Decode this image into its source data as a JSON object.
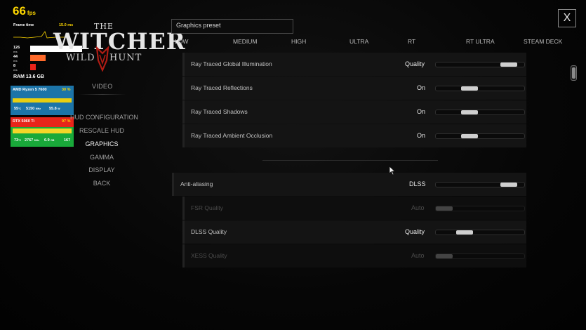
{
  "overlay": {
    "fps_value": "66",
    "fps_unit": "fps",
    "frametime_label": "Frame time",
    "frametime_value": "15.0 ms",
    "bars": [
      {
        "label": "126",
        "unit": "ms",
        "fill": 1.0,
        "color": "#ffffff"
      },
      {
        "label": "44",
        "unit": "ms",
        "fill": 0.25,
        "color": "#ff6a2a"
      },
      {
        "label": "8",
        "unit": "ms",
        "fill": 0.05,
        "color": "#e8241a"
      }
    ],
    "ram_label": "RAM",
    "ram_value": "13.6",
    "ram_unit": "GB",
    "cpu": {
      "name": "AMD Ryzen 5 7600",
      "load": "30 %",
      "temp": "55",
      "temp_unit": "°C",
      "clock": "5150",
      "clock_unit": "MHz",
      "power": "55.8",
      "power_unit": "W"
    },
    "gpu": {
      "name": "RTX 5060 Ti",
      "load": "97 %",
      "temp": "73",
      "temp_unit": "°C",
      "clock": "2767",
      "clock_unit": "MHz",
      "vram": "6.9",
      "vram_unit": "GB",
      "power": "167"
    }
  },
  "logo": {
    "the": "THE",
    "witcher": "WITCHER",
    "wild": "WILD",
    "hunt": "HUNT"
  },
  "nav": {
    "header": "VIDEO",
    "items": [
      {
        "label": "HUD CONFIGURATION",
        "active": false
      },
      {
        "label": "RESCALE HUD",
        "active": false
      },
      {
        "label": "GRAPHICS",
        "active": true
      },
      {
        "label": "GAMMA",
        "active": false
      },
      {
        "label": "DISPLAY",
        "active": false
      },
      {
        "label": "BACK",
        "active": false
      }
    ]
  },
  "close_label": "X",
  "preset": {
    "label": "Graphics preset",
    "options": [
      "LOW",
      "MEDIUM",
      "HIGH",
      "ULTRA",
      "RT",
      "RT ULTRA",
      "STEAM DECK"
    ]
  },
  "settings_rt": [
    {
      "name": "Ray Traced Global Illumination",
      "value": "Quality",
      "level": 0.9
    },
    {
      "name": "Ray Traced Reflections",
      "value": "On",
      "level": 0.35
    },
    {
      "name": "Ray Traced Shadows",
      "value": "On",
      "level": 0.35
    },
    {
      "name": "Ray Traced Ambient Occlusion",
      "value": "On",
      "level": 0.35
    }
  ],
  "settings_aa": [
    {
      "name": "Anti-aliasing",
      "value": "DLSS",
      "level": 0.9,
      "disabled": false
    },
    {
      "name": "FSR Quality",
      "value": "Auto",
      "level": 0.0,
      "disabled": true
    },
    {
      "name": "DLSS Quality",
      "value": "Quality",
      "level": 0.28,
      "disabled": false
    },
    {
      "name": "XESS Quality",
      "value": "Auto",
      "level": 0.0,
      "disabled": true
    }
  ],
  "colors": {
    "fps": "#ffd800",
    "cpu_panel": "#1c74a8",
    "gpu_panel": "#19a93a",
    "accent_red": "#e8241a",
    "text": "#c8c8c8"
  }
}
